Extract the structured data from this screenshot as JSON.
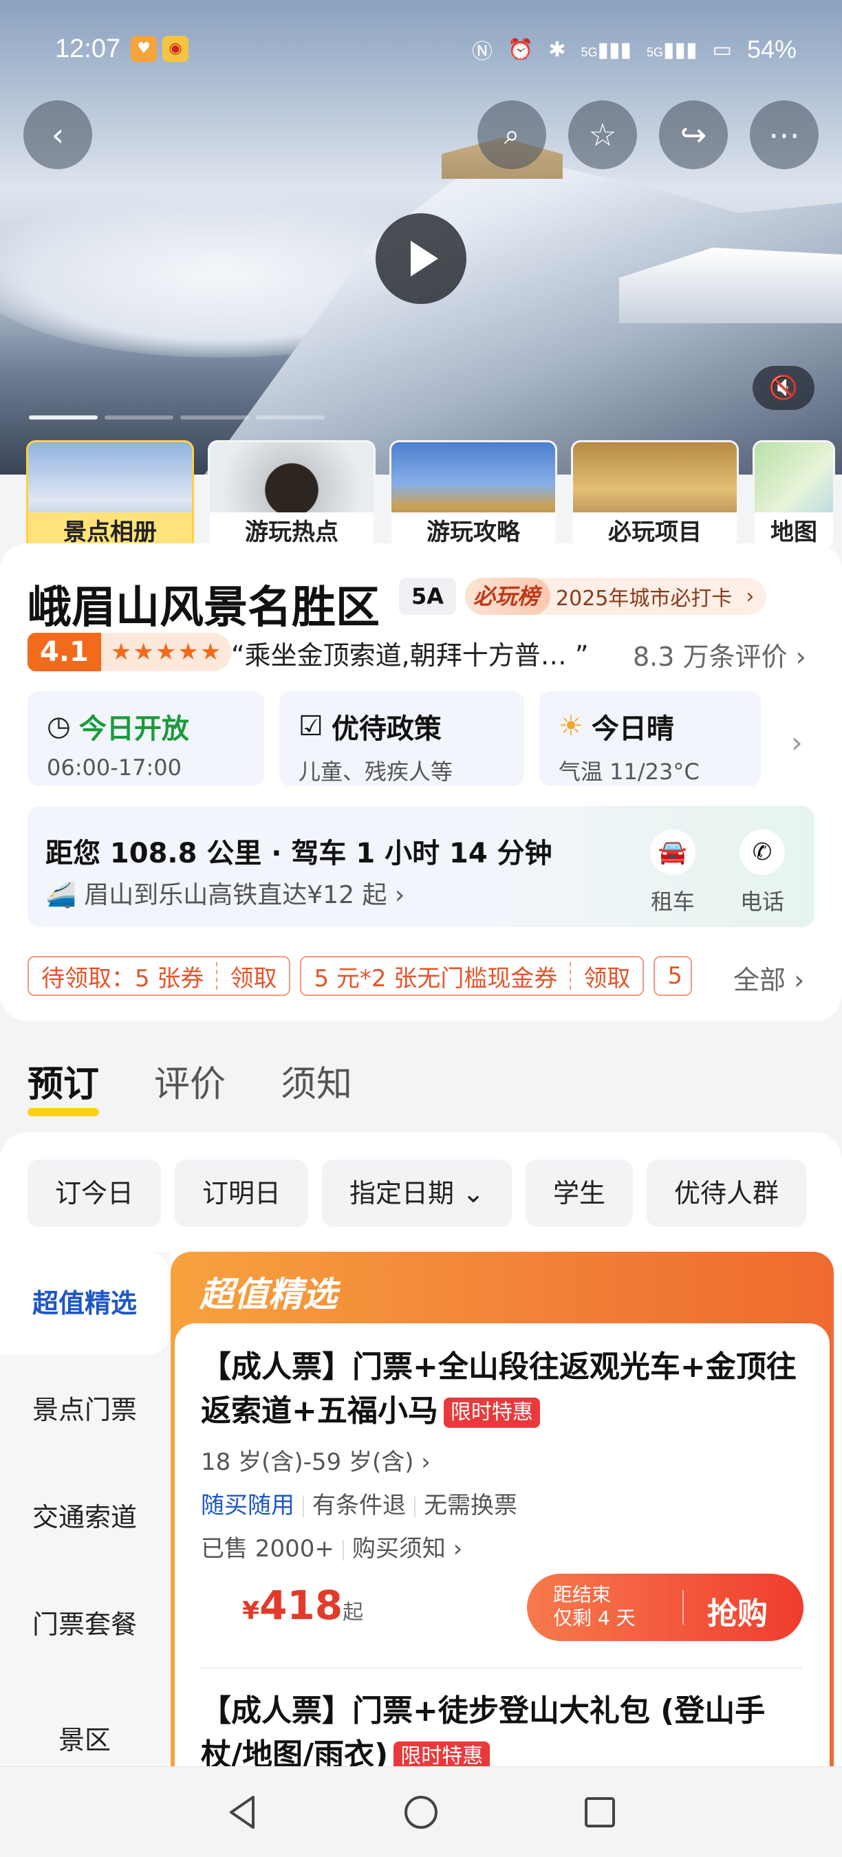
{
  "status_bar": {
    "time": "12:07",
    "battery": "54%",
    "network_1": "5G",
    "network_2": "5G"
  },
  "hero": {
    "thumbnails": [
      {
        "label": "景点相册"
      },
      {
        "label": "游玩热点"
      },
      {
        "label": "游玩攻略"
      },
      {
        "label": "必玩项目"
      },
      {
        "label": "地图"
      }
    ]
  },
  "scenic": {
    "title": "峨眉山风景名胜区",
    "grade": "5A",
    "must_play_tag": "必玩榜",
    "must_play_text": "2025年城市必打卡",
    "score": "4.1",
    "stars": "★★★★★",
    "quote": "“乘坐金顶索道,朝拜十方普…   ”",
    "reviews": "8.3 万条评价"
  },
  "info_pills": [
    {
      "title": "今日开放",
      "sub": "06:00-17:00"
    },
    {
      "title": "优待政策",
      "sub": "儿童、残疾人等"
    },
    {
      "title": "今日晴",
      "sub": "气温 11/23°C"
    }
  ],
  "distance": {
    "main": "距您 108.8 公里 · 驾车 1 小时 14 分钟",
    "sub": "眉山到乐山高铁直达¥12 起 ›",
    "rent_label": "租车",
    "phone_label": "电话"
  },
  "coupons": {
    "c1_text": "待领取：5 张券",
    "c1_action": "领取",
    "c2_text": "5 元*2 张无门槛现金券",
    "c2_action": "领取",
    "c3_text": "5",
    "all": "全部 ›"
  },
  "tabs": [
    {
      "label": "预订"
    },
    {
      "label": "评价"
    },
    {
      "label": "须知"
    }
  ],
  "filters": [
    "订今日",
    "订明日",
    "指定日期 ⌄",
    "学生",
    "优待人群"
  ],
  "side_menu": [
    "超值精选",
    "景点门票",
    "交通索道",
    "门票套餐",
    "景区"
  ],
  "featured": {
    "header": "超值精选",
    "ticket1": {
      "name": "【成人票】门票+全山段往返观光车+金顶往返索道+五福小马",
      "flash": "限时特惠",
      "age": "18 岁(含)-59 岁(含) ›",
      "tag1": "随买随用",
      "tag2": "有条件退",
      "tag3": "无需换票",
      "sold": "已售 2000+",
      "notice": "购买须知 ›",
      "currency": "¥",
      "price": "418",
      "price_suffix": "起",
      "countdown_1": "距结束",
      "countdown_2": "仅剩 4 天",
      "buy": "抢购"
    },
    "ticket2": {
      "name": "【成人票】门票+徒步登山大礼包 (登山手杖/地图/雨衣)",
      "flash": "限时特惠"
    }
  }
}
